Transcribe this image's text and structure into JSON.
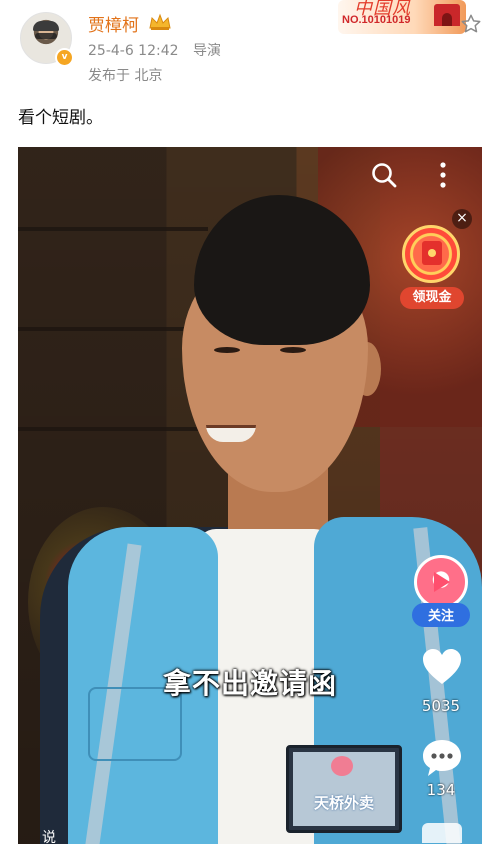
{
  "post": {
    "author_name": "贾樟柯",
    "timestamp": "25-4-6 12:42",
    "role": "导演",
    "location": "发布于 北京",
    "text": "看个短剧。",
    "fan_badge": {
      "script": "中国风",
      "number": "NO.10101019"
    },
    "verified_mark": "v",
    "icons": {
      "crown": "crown-icon",
      "favorite": "star-outline-icon",
      "avatar": "user-avatar"
    }
  },
  "video": {
    "subtitle": "拿不出邀请函",
    "badge_text": "天桥外卖",
    "overlay": {
      "cash_label": "领现金",
      "close_glyph": "×",
      "follow_label": "关注",
      "like_count": "5035",
      "comment_count": "134",
      "bottom_peek": "说"
    },
    "icons": {
      "search": "search-icon",
      "more": "more-vertical-icon",
      "red_packet": "red-packet-icon",
      "creator": "play-circle-icon",
      "like": "heart-icon",
      "comment": "comment-bubble-icon"
    }
  },
  "colors": {
    "author_name": "#e2731a",
    "meta_text": "#8a8a8a",
    "follow_button": "#2f6fe0",
    "cash_label": "#e0462f"
  }
}
